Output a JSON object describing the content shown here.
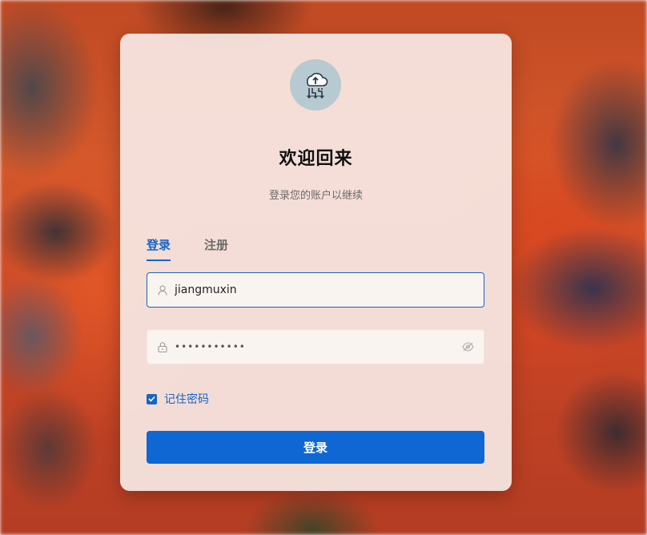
{
  "header": {
    "title": "欢迎回来",
    "subtitle": "登录您的账户以继续"
  },
  "tabs": [
    {
      "label": "登录",
      "active": true
    },
    {
      "label": "注册",
      "active": false
    }
  ],
  "form": {
    "username": {
      "value": "jiangmuxin",
      "icon": "user-icon"
    },
    "password": {
      "value": "•••••••••••",
      "icon": "lock-icon",
      "toggle_icon": "eye-off-icon"
    },
    "remember": {
      "label": "记住密码",
      "checked": true
    },
    "submit_label": "登录"
  },
  "colors": {
    "accent": "#1565c8",
    "button": "#0f67d4",
    "card": "#f6e8e4"
  }
}
